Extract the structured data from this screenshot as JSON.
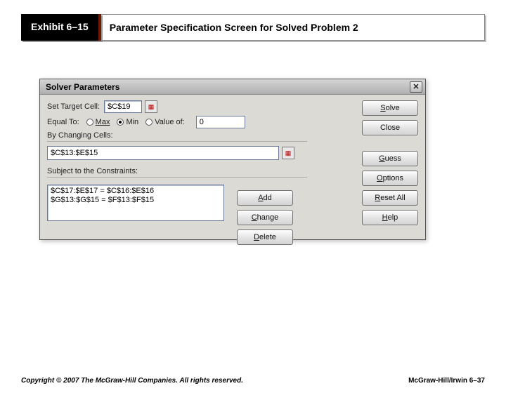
{
  "header": {
    "tag": "Exhibit 6–15",
    "title": "Parameter Specification Screen for Solved Problem 2"
  },
  "dialog": {
    "title": "Solver Parameters",
    "close": "✕",
    "set_target_label": "Set Target Cell:",
    "target_cell": "$C$19",
    "equal_to_label": "Equal To:",
    "opt_max": "Max",
    "opt_min": "Min",
    "opt_value": "Value of:",
    "value_of_value": "0",
    "changing_label": "By Changing Cells:",
    "changing_value": "$C$13:$E$15",
    "constraints_label": "Subject to the Constraints:",
    "constraints": [
      "$C$17:$E$17 = $C$16:$E$16",
      "$G$13:$G$15 = $F$13:$F$15"
    ],
    "buttons": {
      "solve": "Solve",
      "close": "Close",
      "guess": "Guess",
      "options": "Options",
      "add": "Add",
      "change": "Change",
      "delete": "Delete",
      "reset": "Reset All",
      "help": "Help"
    }
  },
  "footer": {
    "left": "Copyright © 2007 The McGraw-Hill Companies. All rights reserved.",
    "right": "McGraw-Hill/Irwin  6–37"
  }
}
